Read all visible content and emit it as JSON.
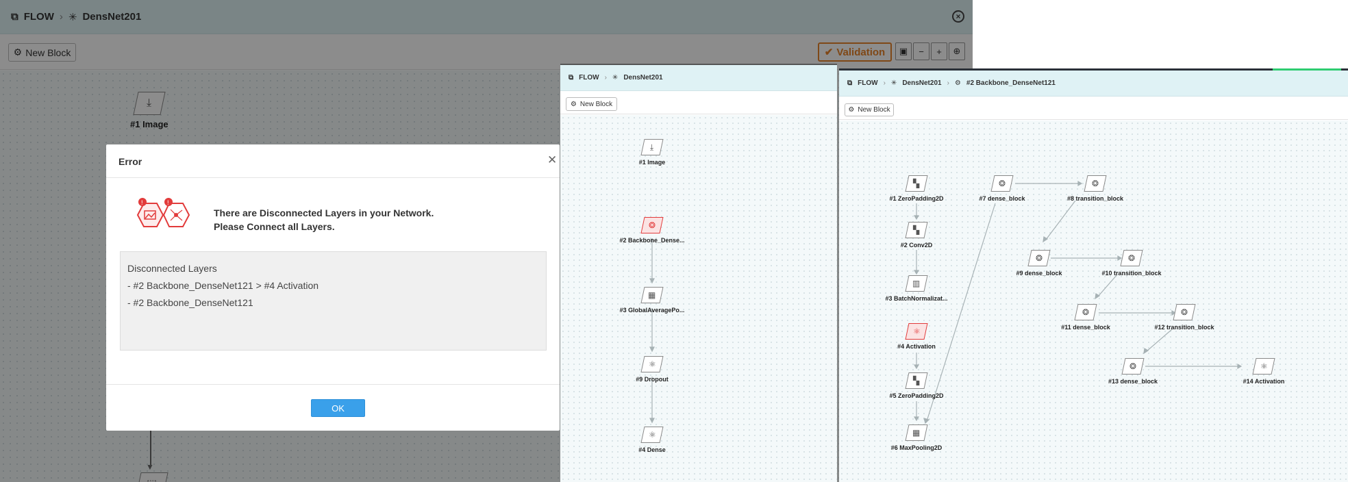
{
  "panel1": {
    "breadcrumb": [
      "FLOW",
      "DensNet201"
    ],
    "new_block_label": "New Block",
    "validation_label": "Validation",
    "nodes": [
      {
        "label": "#1 Image"
      }
    ],
    "modal": {
      "title": "Error",
      "message_line1": "There are Disconnected Layers in your Network.",
      "message_line2": "Please Connect all Layers.",
      "list_title": "Disconnected Layers",
      "list_items": [
        "- #2 Backbone_DenseNet121 > #4 Activation",
        "- #2 Backbone_DenseNet121"
      ],
      "ok_label": "OK"
    }
  },
  "panel2": {
    "breadcrumb": [
      "FLOW",
      "DensNet201"
    ],
    "new_block_label": "New Block",
    "nodes": [
      {
        "label": "#1 Image",
        "icon": "import-icon"
      },
      {
        "label": "#2 Backbone_Dense...",
        "icon": "blocks-icon",
        "error": true
      },
      {
        "label": "#3 GlobalAveragePo...",
        "icon": "pooling-icon"
      },
      {
        "label": "#9 Dropout",
        "icon": "dropout-icon"
      },
      {
        "label": "#4 Dense",
        "icon": "dense-icon"
      }
    ]
  },
  "panel3": {
    "breadcrumb": [
      "FLOW",
      "DensNet201",
      "#2 Backbone_DenseNet121"
    ],
    "new_block_label": "New Block",
    "nodes": [
      {
        "label": "#1 ZeroPadding2D"
      },
      {
        "label": "#2 Conv2D"
      },
      {
        "label": "#3 BatchNormalizat..."
      },
      {
        "label": "#4 Activation",
        "error": true
      },
      {
        "label": "#5 ZeroPadding2D"
      },
      {
        "label": "#6 MaxPooling2D"
      },
      {
        "label": "#7 dense_block"
      },
      {
        "label": "#8 transition_block"
      },
      {
        "label": "#9 dense_block"
      },
      {
        "label": "#10 transition_block"
      },
      {
        "label": "#11 dense_block"
      },
      {
        "label": "#12 transition_block"
      },
      {
        "label": "#13 dense_block"
      },
      {
        "label": "#14 Activation"
      }
    ]
  }
}
